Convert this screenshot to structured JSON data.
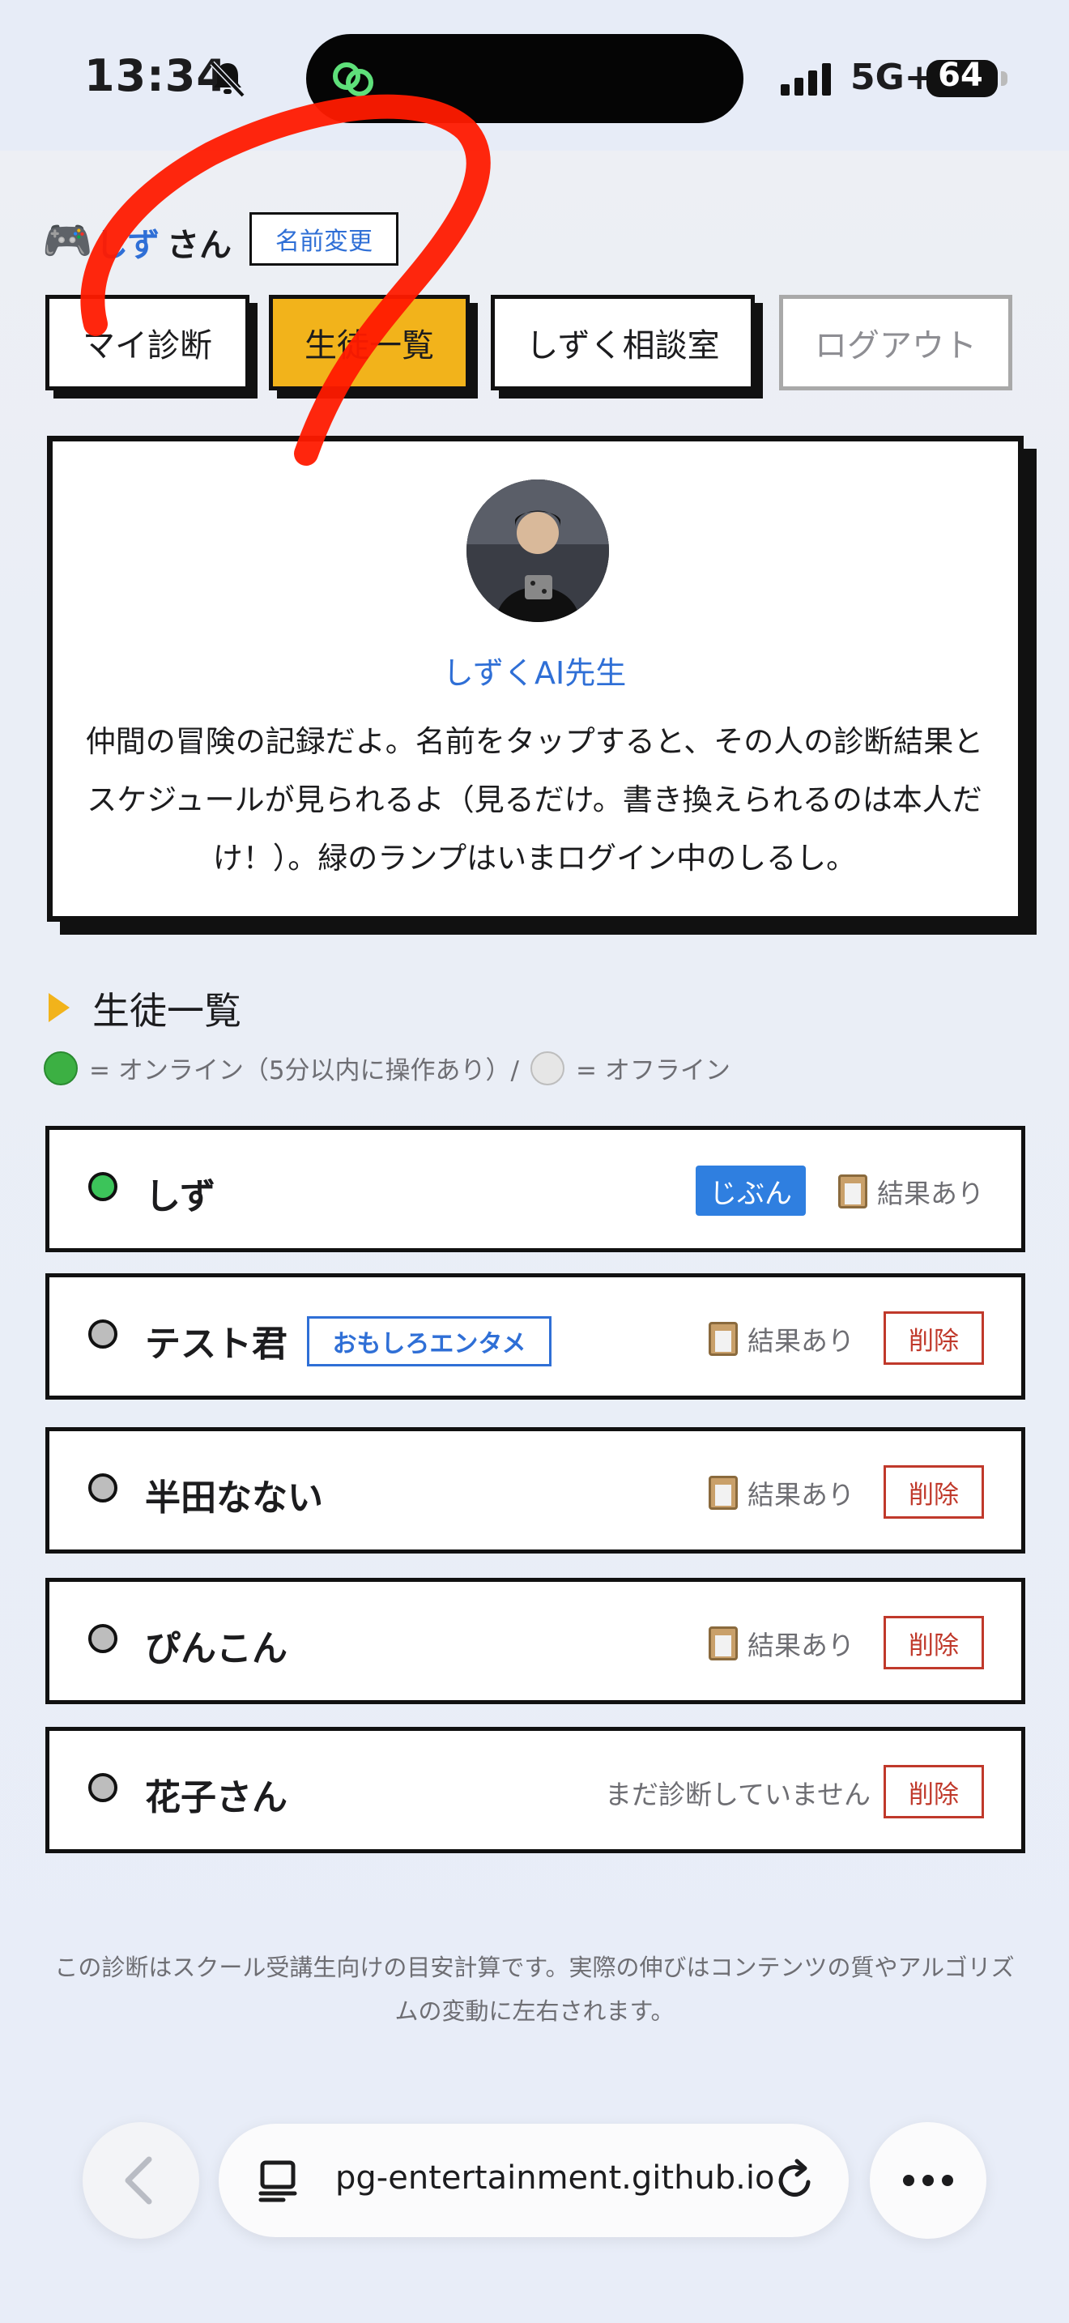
{
  "status_bar": {
    "time": "13:34",
    "network": "5G+",
    "battery": "64"
  },
  "header": {
    "user_name": "しず",
    "user_suffix": "さん",
    "rename_label": "名前変更"
  },
  "nav": {
    "my_diagnosis": "マイ診断",
    "students": "生徒一覧",
    "consult": "しずく相談室",
    "logout": "ログアウト"
  },
  "info": {
    "teacher_name": "しずくAI先生",
    "text": "仲間の冒険の記録だよ。名前をタップすると、その人の診断結果とスケジュールが見られるよ（見るだけ。書き換えられるのは本人だけ！）。緑のランプはいまログイン中のしるし。"
  },
  "section": {
    "title": "生徒一覧",
    "legend_online": "= オンライン（5分以内に操作あり）/",
    "legend_offline": "= オフライン"
  },
  "students": [
    {
      "name": "しず",
      "online": true,
      "self_badge": "じぶん",
      "status": "結果あり"
    },
    {
      "name": "テスト君",
      "online": false,
      "tag": "おもしろエンタメ",
      "status": "結果あり",
      "delete": "削除"
    },
    {
      "name": "半田なない",
      "online": false,
      "status": "結果あり",
      "delete": "削除"
    },
    {
      "name": "ぴんこん",
      "online": false,
      "status": "結果あり",
      "delete": "削除"
    },
    {
      "name": "花子さん",
      "online": false,
      "status": "まだ診断していません",
      "delete": "削除"
    }
  ],
  "disclaimer": "この診断はスクール受講生向けの目安計算です。実際の伸びはコンテンツの質やアルゴリズムの変動に左右されます。",
  "browser": {
    "url": "pg-entertainment.github.io"
  },
  "colors": {
    "accent": "#f2b31b",
    "link": "#2f6fd6",
    "danger": "#c0392b",
    "online": "#3cc45a",
    "annotation": "#ff1a00"
  }
}
